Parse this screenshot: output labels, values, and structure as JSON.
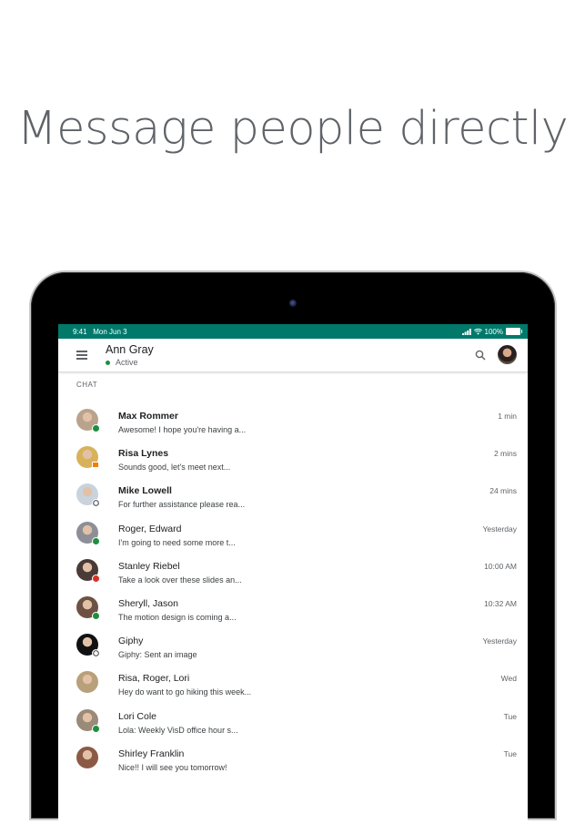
{
  "headline": "Message people directly",
  "status_bar": {
    "time": "9:41",
    "date": "Mon Jun 3",
    "battery": "100%",
    "color": "#00796b"
  },
  "app_bar": {
    "menu_icon": "hamburger-menu-icon",
    "user_name": "Ann Gray",
    "user_status": "Active",
    "search_icon": "search-icon",
    "avatar_icon": "user-avatar"
  },
  "section_label": "CHAT",
  "chats": [
    {
      "name": "Max Rommer",
      "preview": "Awesome! I hope you're having a...",
      "time": "1 min",
      "unread": true,
      "status": "online",
      "avatar_color": "#b9a38d"
    },
    {
      "name": "Risa Lynes",
      "preview": "Sounds good, let's meet next...",
      "time": "2 mins",
      "unread": true,
      "status": "meeting",
      "avatar_color": "#d7b25a"
    },
    {
      "name": "Mike Lowell",
      "preview": "For further assistance please rea...",
      "time": "24 mins",
      "unread": true,
      "status": "away",
      "avatar_color": "#c9d3dc"
    },
    {
      "name": "Roger, Edward",
      "preview": "I'm going to need some more t...",
      "time": "Yesterday",
      "unread": false,
      "status": "online",
      "avatar_color": "#8d8f97"
    },
    {
      "name": "Stanley Riebel",
      "preview": "Take a look over these slides an...",
      "time": "10:00 AM",
      "unread": false,
      "status": "busy",
      "avatar_color": "#4a3b36"
    },
    {
      "name": "Sheryll, Jason",
      "preview": "The motion design is coming  a...",
      "time": "10:32 AM",
      "unread": false,
      "status": "online",
      "avatar_color": "#6d5244"
    },
    {
      "name": "Giphy",
      "preview": "Giphy: Sent an image",
      "time": "Yesterday",
      "unread": false,
      "status": "away",
      "avatar_color": "#111111"
    },
    {
      "name": "Risa, Roger, Lori",
      "preview": "Hey do want to go hiking this week...",
      "time": "Wed",
      "unread": false,
      "status": "none",
      "avatar_color": "#b8a07a"
    },
    {
      "name": "Lori Cole",
      "preview": "Lola: Weekly VisD office hour s...",
      "time": "Tue",
      "unread": false,
      "status": "online",
      "avatar_color": "#9a8a78"
    },
    {
      "name": "Shirley Franklin",
      "preview": "Nice!! I will see you tomorrow!",
      "time": "Tue",
      "unread": false,
      "status": "none",
      "avatar_color": "#8b5a45"
    }
  ]
}
